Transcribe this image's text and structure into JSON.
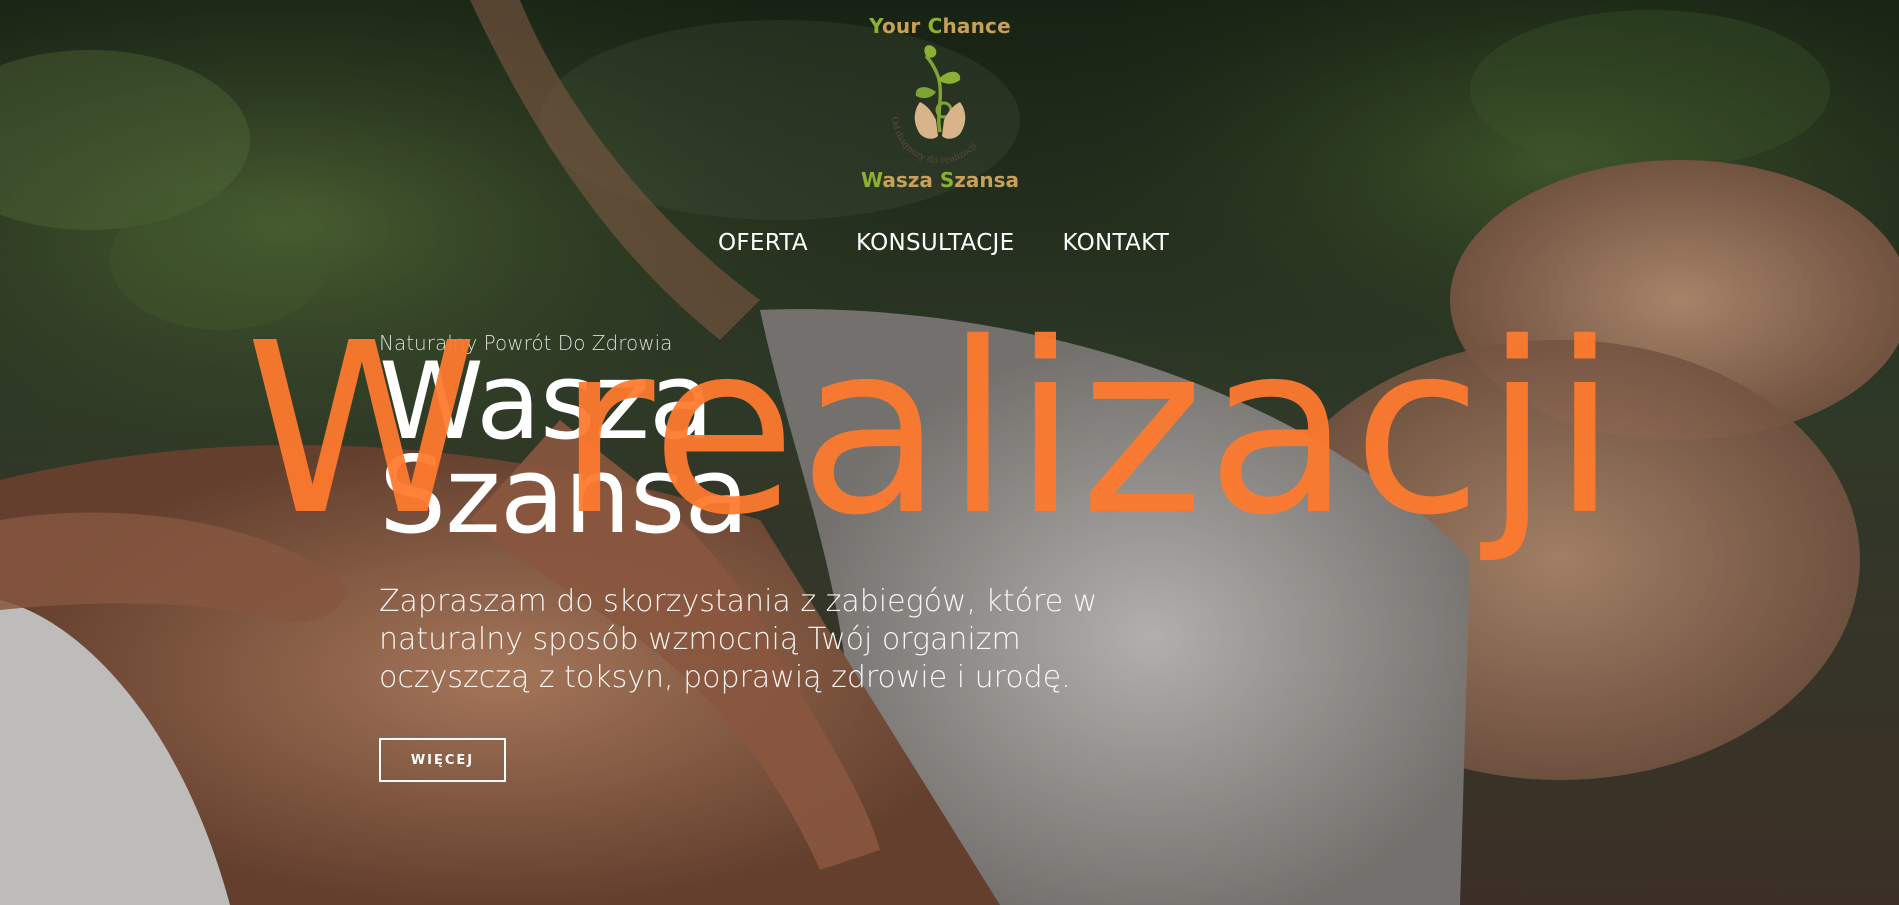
{
  "logo": {
    "top_first": "Y",
    "top_rest": "our ",
    "top_second": "C",
    "top_end": "hance",
    "arc_text": "Od diagnozy do realizacji",
    "bottom_first": "W",
    "bottom_rest": "asza ",
    "bottom_second": "S",
    "bottom_end": "zansa"
  },
  "nav": {
    "items": [
      {
        "label": "OFERTA"
      },
      {
        "label": "KONSULTACJE"
      },
      {
        "label": "KONTAKT"
      }
    ]
  },
  "hero": {
    "eyebrow": "Naturalny Powrót Do Zdrowia",
    "title_line1": "Wasza",
    "title_line2": "Szansa",
    "overlay_word": "W realizacji",
    "lead": "Zapraszam do skorzystania z zabiegów, które w naturalny sposób wzmocnią Twój organizm oczyszczą z toksyn, poprawią zdrowie i urodę.",
    "cta_label": "WIĘCEJ"
  },
  "colors": {
    "accent_orange": "#ff7a2e",
    "logo_green": "#8db034",
    "logo_tan": "#c8a05a"
  }
}
